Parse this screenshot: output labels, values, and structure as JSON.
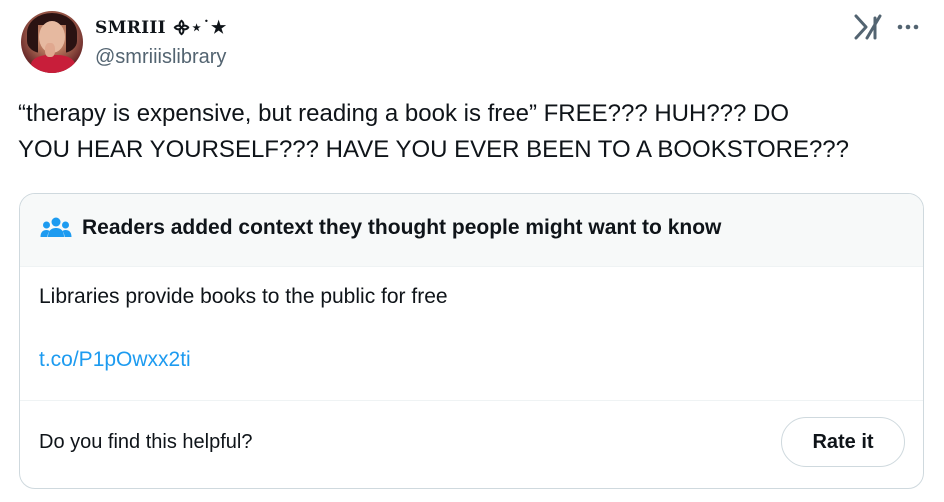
{
  "author": {
    "display_name": "SMRIII ᯽⋆˙★",
    "handle": "@smriiislibrary"
  },
  "header_icons": [
    "grok-icon",
    "more-icon"
  ],
  "tweet": {
    "text": "“therapy is expensive, but reading a book is free” FREE??? HUH??? DO\nYOU HEAR YOURSELF??? HAVE YOU EVER BEEN TO A BOOKSTORE???"
  },
  "community_note": {
    "icon": "people-icon",
    "title": "Readers added context they thought people might want to know",
    "body": "Libraries provide books to the public for free",
    "link": "t.co/P1pOwxx2ti",
    "helpful_prompt": "Do you find this helpful?",
    "rate_label": "Rate it"
  },
  "colors": {
    "text": "#0f1419",
    "secondary_text": "#536471",
    "link": "#1d9bf0",
    "note_header_bg": "#f7f9f9",
    "border": "#cfd9de"
  }
}
